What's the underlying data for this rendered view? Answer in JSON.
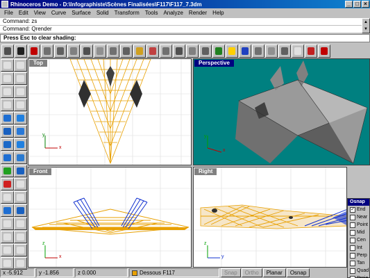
{
  "window": {
    "title": "Rhinoceros Demo - D:\\Infographiste\\Scènes Finalisées\\F117\\F117_7.3dm",
    "min": "_",
    "max": "□",
    "close": "×"
  },
  "menu": [
    "File",
    "Edit",
    "View",
    "Curve",
    "Surface",
    "Solid",
    "Transform",
    "Tools",
    "Analyze",
    "Render",
    "Help"
  ],
  "command_history": [
    "Command: zs",
    "Command: Qrender"
  ],
  "prompt": "Press Esc to clear shading:",
  "toolbar_icons": [
    {
      "name": "rhino-icon",
      "color": "#505050"
    },
    {
      "name": "text-icon",
      "color": "#202020"
    },
    {
      "name": "stop-icon",
      "color": "#c00000"
    },
    {
      "name": "plane-icon",
      "color": "#707070"
    },
    {
      "name": "plane-icon",
      "color": "#606060"
    },
    {
      "name": "plane-icon",
      "color": "#808080"
    },
    {
      "name": "plane-icon",
      "color": "#505050"
    },
    {
      "name": "plane-icon",
      "color": "#909090"
    },
    {
      "name": "plane-icon",
      "color": "#707070"
    },
    {
      "name": "plane-icon",
      "color": "#606060"
    },
    {
      "name": "light-icon",
      "color": "#d0a020"
    },
    {
      "name": "sphere-icon",
      "color": "#c04040"
    },
    {
      "name": "plane-icon",
      "color": "#707070"
    },
    {
      "name": "plane-icon",
      "color": "#505050"
    },
    {
      "name": "plane-icon",
      "color": "#808080"
    },
    {
      "name": "plane-icon",
      "color": "#606060"
    },
    {
      "name": "bottle-icon",
      "color": "#208020"
    },
    {
      "name": "light-icon",
      "color": "#ffd000"
    },
    {
      "name": "ball-icon",
      "color": "#2040c0"
    },
    {
      "name": "plane-icon",
      "color": "#707070"
    },
    {
      "name": "grid-icon",
      "color": "#909090"
    },
    {
      "name": "plane-icon",
      "color": "#606060"
    },
    {
      "name": "title-icon",
      "color": "#e0e0e0"
    },
    {
      "name": "sphere-icon",
      "color": "#c02020"
    },
    {
      "name": "exit-icon",
      "color": "#c00000"
    }
  ],
  "left_tools": [
    {
      "name": "point-icon",
      "color": "#e0e0e0"
    },
    {
      "name": "arc-icon",
      "color": "#e0e0e0"
    },
    {
      "name": "line-icon",
      "color": "#e0e0e0"
    },
    {
      "name": "polyline-icon",
      "color": "#e0e0e0"
    },
    {
      "name": "curve-icon",
      "color": "#e0e0e0"
    },
    {
      "name": "circle-icon",
      "color": "#e0e0e0"
    },
    {
      "name": "hexagon-icon",
      "color": "#e0e0e0"
    },
    {
      "name": "rectangle-icon",
      "color": "#e0e0e0"
    },
    {
      "name": "surface-icon",
      "color": "#1e6ed2"
    },
    {
      "name": "surface-icon",
      "color": "#2080e0"
    },
    {
      "name": "surface-icon",
      "color": "#1860c0"
    },
    {
      "name": "surface-icon",
      "color": "#2878d8"
    },
    {
      "name": "box-icon",
      "color": "#1a68c8"
    },
    {
      "name": "sphere-icon",
      "color": "#2080e0"
    },
    {
      "name": "cylinder-icon",
      "color": "#1e6ed2"
    },
    {
      "name": "cone-icon",
      "color": "#2a7ad0"
    },
    {
      "name": "torus-icon",
      "color": "#20a020"
    },
    {
      "name": "solid-icon",
      "color": "#1860c0"
    },
    {
      "name": "move-icon",
      "color": "#d02020"
    },
    {
      "name": "rotate-icon",
      "color": "#e0e0e0"
    },
    {
      "name": "scale-icon",
      "color": "#e0e0e0"
    },
    {
      "name": "mirror-icon",
      "color": "#e0e0e0"
    },
    {
      "name": "array-icon",
      "color": "#1e6ed2"
    },
    {
      "name": "boolean-icon",
      "color": "#1860c0"
    },
    {
      "name": "trim-icon",
      "color": "#e0e0e0"
    },
    {
      "name": "split-icon",
      "color": "#e0e0e0"
    },
    {
      "name": "explode-icon",
      "color": "#e0e0e0"
    },
    {
      "name": "join-icon",
      "color": "#e0e0e0"
    },
    {
      "name": "dim-icon",
      "color": "#e0e0e0"
    },
    {
      "name": "text-icon",
      "color": "#e0e0e0"
    },
    {
      "name": "layer-icon",
      "color": "#e0e0e0"
    },
    {
      "name": "properties-icon",
      "color": "#e0e0e0"
    }
  ],
  "viewports": {
    "top": {
      "label": "Top",
      "label_bg": "#808080",
      "bg": "#ffffff"
    },
    "perspective": {
      "label": "Perspective",
      "label_bg": "#000080",
      "bg": "#008080"
    },
    "front": {
      "label": "Front",
      "label_bg": "#808080",
      "bg": "#ffffff"
    },
    "right": {
      "label": "Right",
      "label_bg": "#808080",
      "bg": "#ffffff"
    }
  },
  "axes": {
    "x": "x",
    "y": "y",
    "z": "z"
  },
  "status": {
    "x": "x  -5.912",
    "y": "y  -1.856",
    "z": "z  0.000",
    "layer": "Dessous F117",
    "layer_color": "#e8a000",
    "snap": "Snap",
    "ortho": "Ortho",
    "planar": "Planar",
    "osnap": "Osnap"
  },
  "osnap": {
    "title": "Osnap",
    "items": [
      {
        "label": "End",
        "checked": true
      },
      {
        "label": "Near",
        "checked": false
      },
      {
        "label": "Point",
        "checked": false
      },
      {
        "label": "Mid",
        "checked": false
      },
      {
        "label": "Cen",
        "checked": false
      },
      {
        "label": "Int",
        "checked": false
      },
      {
        "label": "Perp",
        "checked": false
      },
      {
        "label": "Tan",
        "checked": false
      },
      {
        "label": "Quad",
        "checked": false
      },
      {
        "label": "Proje",
        "checked": false
      }
    ]
  }
}
